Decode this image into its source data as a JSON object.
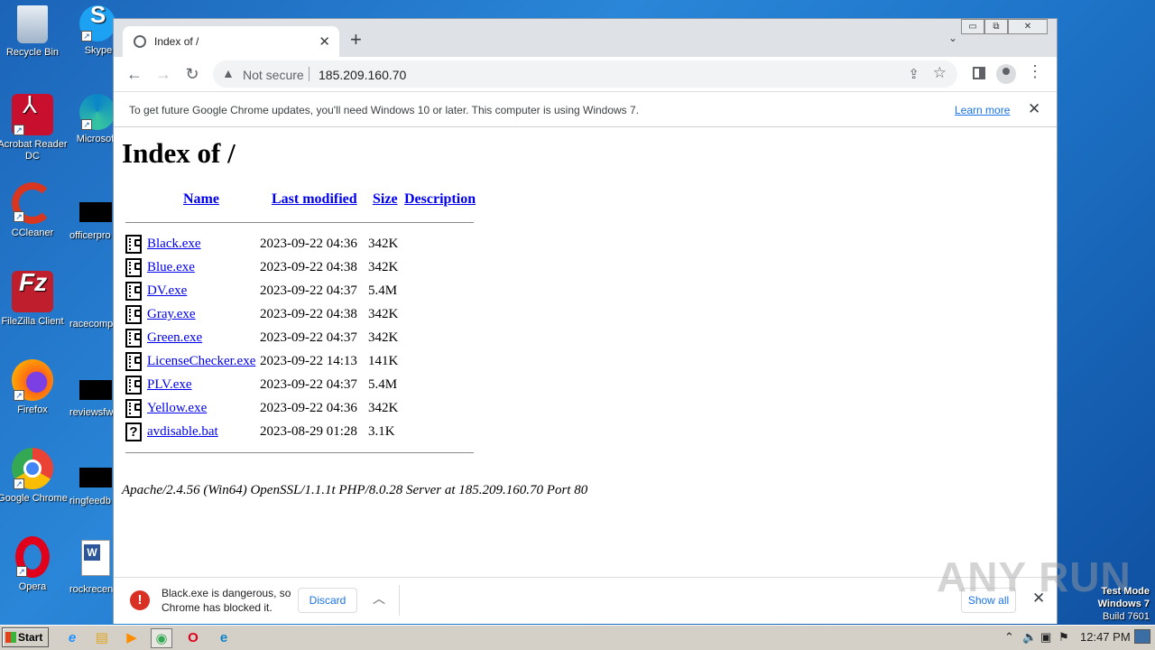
{
  "desktop": {
    "icons": [
      {
        "label": "Recycle Bin",
        "color": "#b9c8d8"
      },
      {
        "label": "Skype",
        "color": "#1da1f2"
      },
      {
        "label": "Acrobat Reader DC",
        "color": "#c8102e"
      },
      {
        "label": "Microsoft",
        "color": "#1a8ad4"
      },
      {
        "label": "CCleaner",
        "color": "#d9361f"
      },
      {
        "label": "officerpro",
        "color": "#000000"
      },
      {
        "label": "FileZilla Client",
        "color": "#bf1e2d"
      },
      {
        "label": "racecomp",
        "color": "#000000"
      },
      {
        "label": "Firefox",
        "color": "#ff6a13"
      },
      {
        "label": "reviewsfw",
        "color": "#000000"
      },
      {
        "label": "Google Chrome",
        "color": "#34a853"
      },
      {
        "label": "ringfeedb",
        "color": "#000000"
      },
      {
        "label": "Opera",
        "color": "#e0001b"
      },
      {
        "label": "rockrecen",
        "color": "#2b579a"
      }
    ]
  },
  "browser": {
    "tab": {
      "title": "Index of /",
      "close": "✕"
    },
    "new_tab": "+",
    "tab_dropdown": "⌄",
    "window_controls": {
      "minimize": "▭",
      "restore": "⧉",
      "close": "✕"
    },
    "nav": {
      "back": "←",
      "forward": "→",
      "reload": "↻"
    },
    "omnibox": {
      "warning_icon": "▲",
      "security_label": "Not secure",
      "url": "185.209.160.70",
      "share": "⇪",
      "bookmark": "☆"
    },
    "menu": "⋮",
    "infobar": {
      "message": "To get future Google Chrome updates, you'll need Windows 10 or later. This computer is using Windows 7.",
      "link": "Learn more",
      "close": "✕"
    }
  },
  "page": {
    "heading": "Index of /",
    "columns": {
      "name": "Name",
      "modified": "Last modified",
      "size": "Size",
      "description": "Description"
    },
    "rows": [
      {
        "name": "Black.exe",
        "modified": "2023-09-22 04:36",
        "size": "342K",
        "icon": "exe"
      },
      {
        "name": "Blue.exe",
        "modified": "2023-09-22 04:38",
        "size": "342K",
        "icon": "exe"
      },
      {
        "name": "DV.exe",
        "modified": "2023-09-22 04:37",
        "size": "5.4M",
        "icon": "exe"
      },
      {
        "name": "Gray.exe",
        "modified": "2023-09-22 04:38",
        "size": "342K",
        "icon": "exe"
      },
      {
        "name": "Green.exe",
        "modified": "2023-09-22 04:37",
        "size": "342K",
        "icon": "exe"
      },
      {
        "name": "LicenseChecker.exe",
        "modified": "2023-09-22 14:13",
        "size": "141K",
        "icon": "exe"
      },
      {
        "name": "PLV.exe",
        "modified": "2023-09-22 04:37",
        "size": "5.4M",
        "icon": "exe"
      },
      {
        "name": "Yellow.exe",
        "modified": "2023-09-22 04:36",
        "size": "342K",
        "icon": "exe"
      },
      {
        "name": "avdisable.bat",
        "modified": "2023-08-29 01:28",
        "size": "3.1K",
        "icon": "bat"
      }
    ],
    "unknown_icon_glyph": "?",
    "server_signature": "Apache/2.4.56 (Win64) OpenSSL/1.1.1t PHP/8.0.28 Server at 185.209.160.70 Port 80"
  },
  "download_bar": {
    "error_icon": "!",
    "message": "Black.exe is dangerous, so Chrome has blocked it.",
    "discard": "Discard",
    "expand": "︿",
    "show_all": "Show all",
    "close": "✕"
  },
  "watermark": "ANY RUN",
  "test_mode": {
    "line1": "Test Mode",
    "line2": "Windows 7",
    "line3": "Build 7601"
  },
  "taskbar": {
    "start": "Start",
    "pinned": [
      {
        "name": "ie-icon",
        "glyph": "e",
        "color": "#1e90ff"
      },
      {
        "name": "explorer-icon",
        "glyph": "▤",
        "color": "#e0a520"
      },
      {
        "name": "media-player-icon",
        "glyph": "▶",
        "color": "#ff8c00"
      },
      {
        "name": "chrome-icon",
        "glyph": "◉",
        "color": "#34a853"
      },
      {
        "name": "opera-icon",
        "glyph": "O",
        "color": "#e0001b"
      },
      {
        "name": "edge-icon",
        "glyph": "e",
        "color": "#0a84c8"
      }
    ],
    "tray": {
      "chevron": "⌃",
      "volume": "🔈",
      "network": "▣",
      "flag": "⚑"
    },
    "clock": "12:47 PM"
  },
  "colors": {
    "link": "#0000ee",
    "accent": "#1a73e8",
    "danger": "#d93025"
  }
}
